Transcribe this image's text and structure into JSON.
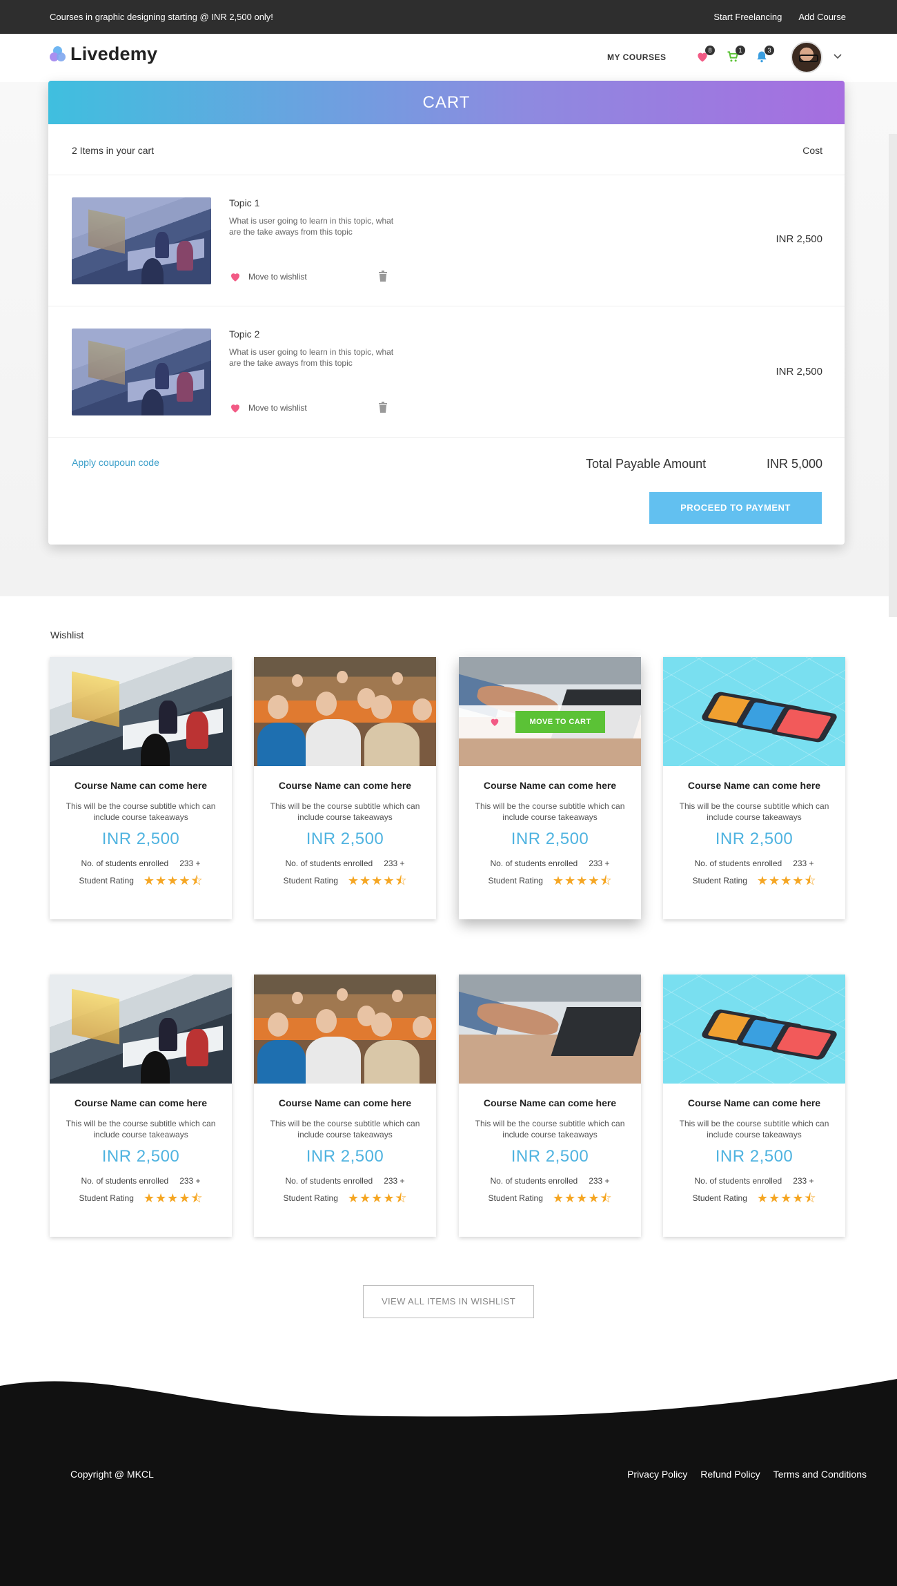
{
  "topbar": {
    "promo": "Courses in graphic designing starting  @ INR 2,500 only!",
    "links": [
      "Start Freelancing",
      "Add Course"
    ]
  },
  "header": {
    "brand": "Livedemy",
    "nav_my_courses": "MY COURSES",
    "badges": {
      "wishlist": "8",
      "cart": "1",
      "notifications": "3"
    }
  },
  "cart": {
    "title": "CART",
    "count_label": "2 Items in your cart",
    "cost_label": "Cost",
    "items": [
      {
        "title": "Topic 1",
        "description": "What is user going to learn in this topic, what are the take aways from this topic",
        "wishlist_label": "Move to wishlist",
        "price": "INR 2,500"
      },
      {
        "title": "Topic 2",
        "description": "What is user going to learn in this topic, what are the take aways from this topic",
        "wishlist_label": "Move to wishlist",
        "price": "INR 2,500"
      }
    ],
    "coupon_label": "Apply coupoun code",
    "total_label": "Total Payable Amount",
    "total_value": "INR 5,000",
    "pay_button": "PROCEED TO PAYMENT"
  },
  "wishlist": {
    "title": "Wishlist",
    "move_to_cart": "MOVE TO CART",
    "cards": [
      {
        "name": "Course Name can come here",
        "subtitle": "This will be the course subtitle which can include course takeaways",
        "price": "INR 2,500",
        "enrolled_label": "No. of students enrolled",
        "enrolled": "233 +",
        "rating_label": "Student Rating",
        "rating": 4.5,
        "image": "classroom"
      },
      {
        "name": "Course Name can come here",
        "subtitle": "This will be the course subtitle which can include course takeaways",
        "price": "INR 2,500",
        "enrolled_label": "No. of students enrolled",
        "enrolled": "233 +",
        "rating_label": "Student Rating",
        "rating": 4.5,
        "image": "audience"
      },
      {
        "name": "Course Name can come here",
        "subtitle": "This will be the course subtitle which can include course takeaways",
        "price": "INR 2,500",
        "enrolled_label": "No. of students enrolled",
        "enrolled": "233 +",
        "rating_label": "Student Rating",
        "rating": 4.5,
        "image": "laptop"
      },
      {
        "name": "Course Name can come here",
        "subtitle": "This will be the course subtitle which can include course takeaways",
        "price": "INR 2,500",
        "enrolled_label": "No. of students enrolled",
        "enrolled": "233 +",
        "rating_label": "Student Rating",
        "rating": 4.5,
        "image": "phones"
      },
      {
        "name": "Course Name can come here",
        "subtitle": "This will be the course subtitle which can include course takeaways",
        "price": "INR 2,500",
        "enrolled_label": "No. of students enrolled",
        "enrolled": "233 +",
        "rating_label": "Student Rating",
        "rating": 4.5,
        "image": "classroom"
      },
      {
        "name": "Course Name can come here",
        "subtitle": "This will be the course subtitle which can include course takeaways",
        "price": "INR 2,500",
        "enrolled_label": "No. of students enrolled",
        "enrolled": "233 +",
        "rating_label": "Student Rating",
        "rating": 4.5,
        "image": "audience"
      },
      {
        "name": "Course Name can come here",
        "subtitle": "This will be the course subtitle which can include course takeaways",
        "price": "INR 2,500",
        "enrolled_label": "No. of students enrolled",
        "enrolled": "233 +",
        "rating_label": "Student Rating",
        "rating": 4.5,
        "image": "laptop"
      },
      {
        "name": "Course Name can come here",
        "subtitle": "This will be the course subtitle which can include course takeaways",
        "price": "INR 2,500",
        "enrolled_label": "No. of students enrolled",
        "enrolled": "233 +",
        "rating_label": "Student Rating",
        "rating": 4.5,
        "image": "phones"
      }
    ],
    "view_all": "VIEW ALL ITEMS IN WISHLIST"
  },
  "footer": {
    "copyright": "Copyright @ MKCL",
    "links": [
      "Privacy Policy",
      "Refund Policy",
      "Terms and Conditions"
    ]
  },
  "colors": {
    "accent_blue": "#4fb3e0",
    "pay_button": "#62c0f0",
    "move_to_cart": "#5bc236",
    "heart": "#f25a85",
    "star": "#f5a623",
    "footer_bg": "#111111"
  }
}
